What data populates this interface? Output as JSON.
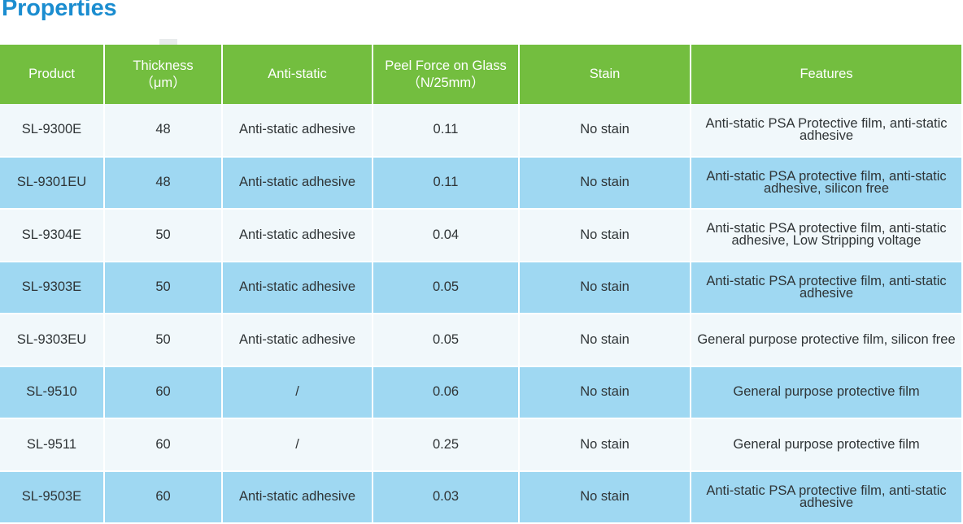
{
  "page": {
    "title": "Properties",
    "title_color": "#1b8dd0"
  },
  "table": {
    "header_bg": "#73be3f",
    "row_odd_bg": "#f1f8fb",
    "row_even_bg": "#9fd8f2",
    "grid_color": "#ffffff",
    "columns": [
      {
        "key": "product",
        "label": "Product",
        "label_line2": ""
      },
      {
        "key": "thickness",
        "label": "Thickness",
        "label_line2": "（μm）"
      },
      {
        "key": "antistatic",
        "label": "Anti-static",
        "label_line2": ""
      },
      {
        "key": "peel",
        "label": "Peel Force on Glass",
        "label_line2": "（N/25mm）"
      },
      {
        "key": "stain",
        "label": "Stain",
        "label_line2": ""
      },
      {
        "key": "features",
        "label": "Features",
        "label_line2": ""
      }
    ],
    "rows": [
      {
        "product": "SL-9300E",
        "thickness": "48",
        "antistatic": "Anti-static adhesive",
        "peel": "0.11",
        "stain": "No stain",
        "features": "Anti-static PSA Protective film, anti-static adhesive"
      },
      {
        "product": "SL-9301EU",
        "thickness": "48",
        "antistatic": "Anti-static adhesive",
        "peel": "0.11",
        "stain": "No stain",
        "features": "Anti-static PSA protective film, anti-static adhesive,  silicon free"
      },
      {
        "product": "SL-9304E",
        "thickness": "50",
        "antistatic": "Anti-static adhesive",
        "peel": "0.04",
        "stain": "No stain",
        "features": "Anti-static PSA protective film, anti-static adhesive, Low Stripping voltage"
      },
      {
        "product": "SL-9303E",
        "thickness": "50",
        "antistatic": "Anti-static adhesive",
        "peel": "0.05",
        "stain": "No stain",
        "features": "Anti-static PSA protective film, anti-static adhesive"
      },
      {
        "product": "SL-9303EU",
        "thickness": "50",
        "antistatic": "Anti-static adhesive",
        "peel": "0.05",
        "stain": "No stain",
        "features": "General purpose protective film, silicon free"
      },
      {
        "product": "SL-9510",
        "thickness": "60",
        "antistatic": "/",
        "peel": "0.06",
        "stain": "No stain",
        "features": "General purpose protective film"
      },
      {
        "product": "SL-9511",
        "thickness": "60",
        "antistatic": "/",
        "peel": "0.25",
        "stain": "No stain",
        "features": "General purpose protective film"
      },
      {
        "product": "SL-9503E",
        "thickness": "60",
        "antistatic": "Anti-static adhesive",
        "peel": "0.03",
        "stain": "No stain",
        "features": "Anti-static PSA protective film, anti-static adhesive"
      }
    ]
  }
}
